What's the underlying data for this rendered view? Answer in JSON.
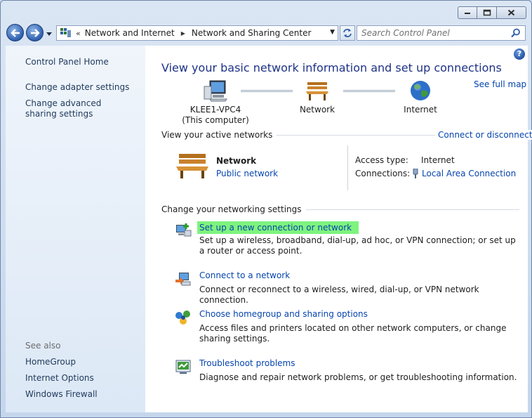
{
  "window": {
    "controls": {
      "minimize": "minimize",
      "maximize": "maximize",
      "close": "close"
    }
  },
  "nav": {
    "breadcrumb": [
      {
        "label": "Network and Internet"
      },
      {
        "label": "Network and Sharing Center"
      }
    ],
    "overflow_chevron": "«",
    "search_placeholder": "Search Control Panel"
  },
  "left_pane": {
    "links": [
      {
        "label": "Control Panel Home"
      },
      {
        "label": "Change adapter settings"
      },
      {
        "label": "Change advanced sharing settings"
      }
    ],
    "see_also_label": "See also",
    "see_also_links": [
      {
        "label": "HomeGroup"
      },
      {
        "label": "Internet Options"
      },
      {
        "label": "Windows Firewall"
      }
    ]
  },
  "main": {
    "title": "View your basic network information and set up connections",
    "see_full_map": "See full map",
    "map": {
      "computer_name": "KLEE1-VPC4",
      "computer_sub": "(This computer)",
      "network": "Network",
      "internet": "Internet"
    },
    "active_networks": {
      "label": "View your active networks",
      "connect_link": "Connect or disconnect",
      "network_name": "Network",
      "network_type": "Public network",
      "access_type_label": "Access type:",
      "access_type_value": "Internet",
      "connections_label": "Connections:",
      "connections_value": "Local Area Connection"
    },
    "settings": {
      "label": "Change your networking settings",
      "tasks": [
        {
          "title": "Set up a new connection or network",
          "desc": "Set up a wireless, broadband, dial-up, ad hoc, or VPN connection; or set up a router or access point.",
          "icon": "new-connection-icon"
        },
        {
          "title": "Connect to a network",
          "desc": "Connect or reconnect to a wireless, wired, dial-up, or VPN network connection.",
          "icon": "connect-network-icon"
        },
        {
          "title": "Choose homegroup and sharing options",
          "desc": "Access files and printers located on other network computers, or change sharing settings.",
          "icon": "homegroup-icon"
        },
        {
          "title": "Troubleshoot problems",
          "desc": "Diagnose and repair network problems, or get troubleshooting information.",
          "icon": "troubleshoot-icon"
        }
      ]
    }
  },
  "colors": {
    "link": "#0645ad",
    "title": "#1e3287",
    "highlight": "#7ef47e",
    "left_pane_bg": "#e6eef8"
  }
}
